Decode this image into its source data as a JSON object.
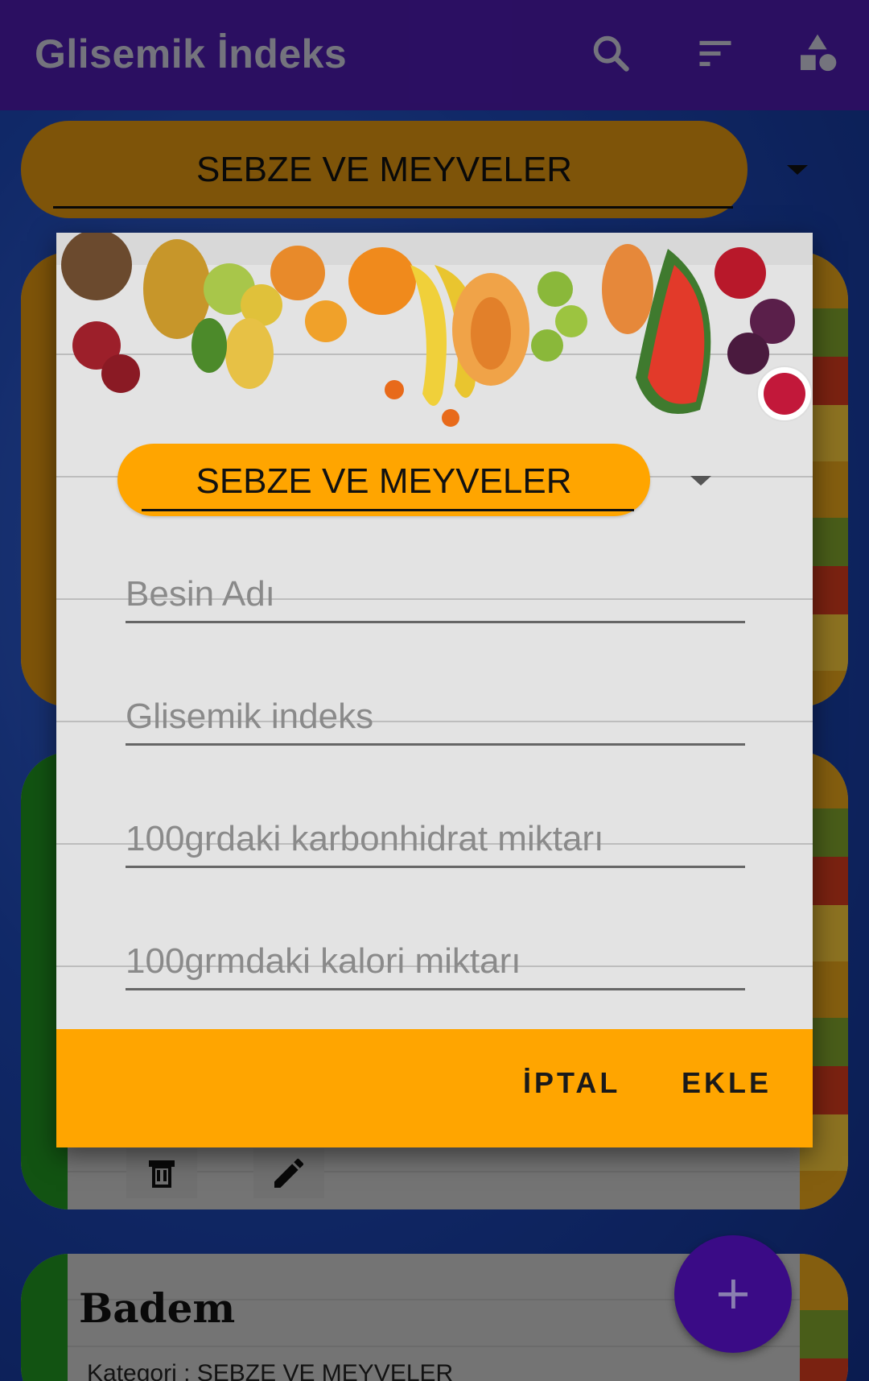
{
  "app": {
    "title": "Glisemik İndeks",
    "icons": [
      "search-icon",
      "sort-icon",
      "shapes-icon"
    ]
  },
  "category_spinner": {
    "selected": "SEBZE VE MEYVELER"
  },
  "cards": [
    {
      "stripe_color": "#d99211"
    },
    {
      "stripe_color": "#1f8f1f",
      "actions": [
        "delete-icon",
        "edit-icon"
      ]
    },
    {
      "stripe_color": "#1f8f1f",
      "name": "Badem",
      "category_text": "Kategori : SEBZE VE MEYVELER"
    }
  ],
  "fab": {
    "icon": "add-icon"
  },
  "dialog": {
    "category_selected": "SEBZE VE MEYVELER",
    "fields": [
      {
        "placeholder": "Besin Adı",
        "value": ""
      },
      {
        "placeholder": "Glisemik indeks",
        "value": ""
      },
      {
        "placeholder": "100grdaki karbonhidrat miktarı",
        "value": ""
      },
      {
        "placeholder": "100grmdaki kalori miktarı",
        "value": ""
      }
    ],
    "buttons": {
      "cancel": "İPTAL",
      "add": "EKLE"
    },
    "colors": {
      "accent": "#ffa500"
    }
  }
}
